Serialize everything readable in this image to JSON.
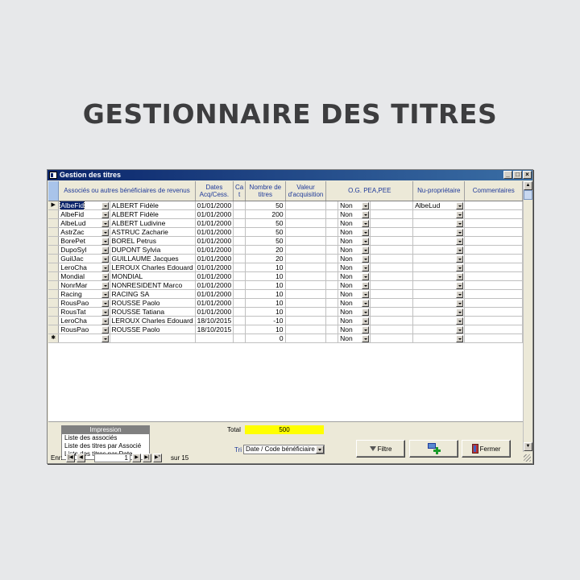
{
  "page_title": "GESTIONNAIRE DES TITRES",
  "window": {
    "title": "Gestion des titres",
    "minimize": "_",
    "maximize": "□",
    "close": "×"
  },
  "columns": [
    "Associés ou autres bénéficiaires de revenus",
    "Dates Acq/Cess.",
    "Ca t",
    "Nombre de titres",
    "Valeur d'acquisition",
    "O.G. PEA,PEE",
    "Nu-propriétaire",
    "Commentaires"
  ],
  "rows": [
    {
      "code": "AlbeFid",
      "name": "ALBERT Fidèle",
      "date": "01/01/2000",
      "nombre": "50",
      "og": "Non",
      "nu": "AlbeLud",
      "current": true
    },
    {
      "code": "AlbeFid",
      "name": "ALBERT Fidèle",
      "date": "01/01/2000",
      "nombre": "200",
      "og": "Non",
      "nu": ""
    },
    {
      "code": "AlbeLud",
      "name": "ALBERT Ludivine",
      "date": "01/01/2000",
      "nombre": "50",
      "og": "Non",
      "nu": ""
    },
    {
      "code": "AstrZac",
      "name": "ASTRUC Zacharie",
      "date": "01/01/2000",
      "nombre": "50",
      "og": "Non",
      "nu": ""
    },
    {
      "code": "BorePet",
      "name": "BOREL Petrus",
      "date": "01/01/2000",
      "nombre": "50",
      "og": "Non",
      "nu": ""
    },
    {
      "code": "DupoSyl",
      "name": "DUPONT Sylvia",
      "date": "01/01/2000",
      "nombre": "20",
      "og": "Non",
      "nu": ""
    },
    {
      "code": "GuilJac",
      "name": "GUILLAUME Jacques",
      "date": "01/01/2000",
      "nombre": "20",
      "og": "Non",
      "nu": ""
    },
    {
      "code": "LeroCha",
      "name": "LEROUX Charles Edouard",
      "date": "01/01/2000",
      "nombre": "10",
      "og": "Non",
      "nu": ""
    },
    {
      "code": "Mondial",
      "name": "MONDIAL",
      "date": "01/01/2000",
      "nombre": "10",
      "og": "Non",
      "nu": ""
    },
    {
      "code": "NonrMar",
      "name": "NONRESIDENT Marco",
      "date": "01/01/2000",
      "nombre": "10",
      "og": "Non",
      "nu": ""
    },
    {
      "code": "Racing",
      "name": "RACING SA",
      "date": "01/01/2000",
      "nombre": "10",
      "og": "Non",
      "nu": ""
    },
    {
      "code": "RousPao",
      "name": "ROUSSE Paolo",
      "date": "01/01/2000",
      "nombre": "10",
      "og": "Non",
      "nu": ""
    },
    {
      "code": "RousTat",
      "name": "ROUSSE Tatiana",
      "date": "01/01/2000",
      "nombre": "10",
      "og": "Non",
      "nu": ""
    },
    {
      "code": "LeroCha",
      "name": "LEROUX Charles Edouard",
      "date": "18/10/2015",
      "nombre": "-10",
      "og": "Non",
      "nu": ""
    },
    {
      "code": "RousPao",
      "name": "ROUSSE Paolo",
      "date": "18/10/2015",
      "nombre": "10",
      "og": "Non",
      "nu": ""
    },
    {
      "code": "",
      "name": "",
      "date": "",
      "nombre": "0",
      "og": "Non",
      "nu": "",
      "new": true
    }
  ],
  "footer": {
    "print_title": "Impression",
    "print_items": [
      "Liste des associés",
      "Liste des titres par Associé",
      "Liste des titres par Date"
    ],
    "total_label": "Total",
    "total_value": "500",
    "tri_label": "Tri",
    "tri_value": "Date / Code bénéficiaire",
    "filter_label": "Filtre",
    "close_label": "Fermer"
  },
  "nav": {
    "label": "Enr:",
    "current": "1",
    "of_label": "sur",
    "total": "15"
  }
}
